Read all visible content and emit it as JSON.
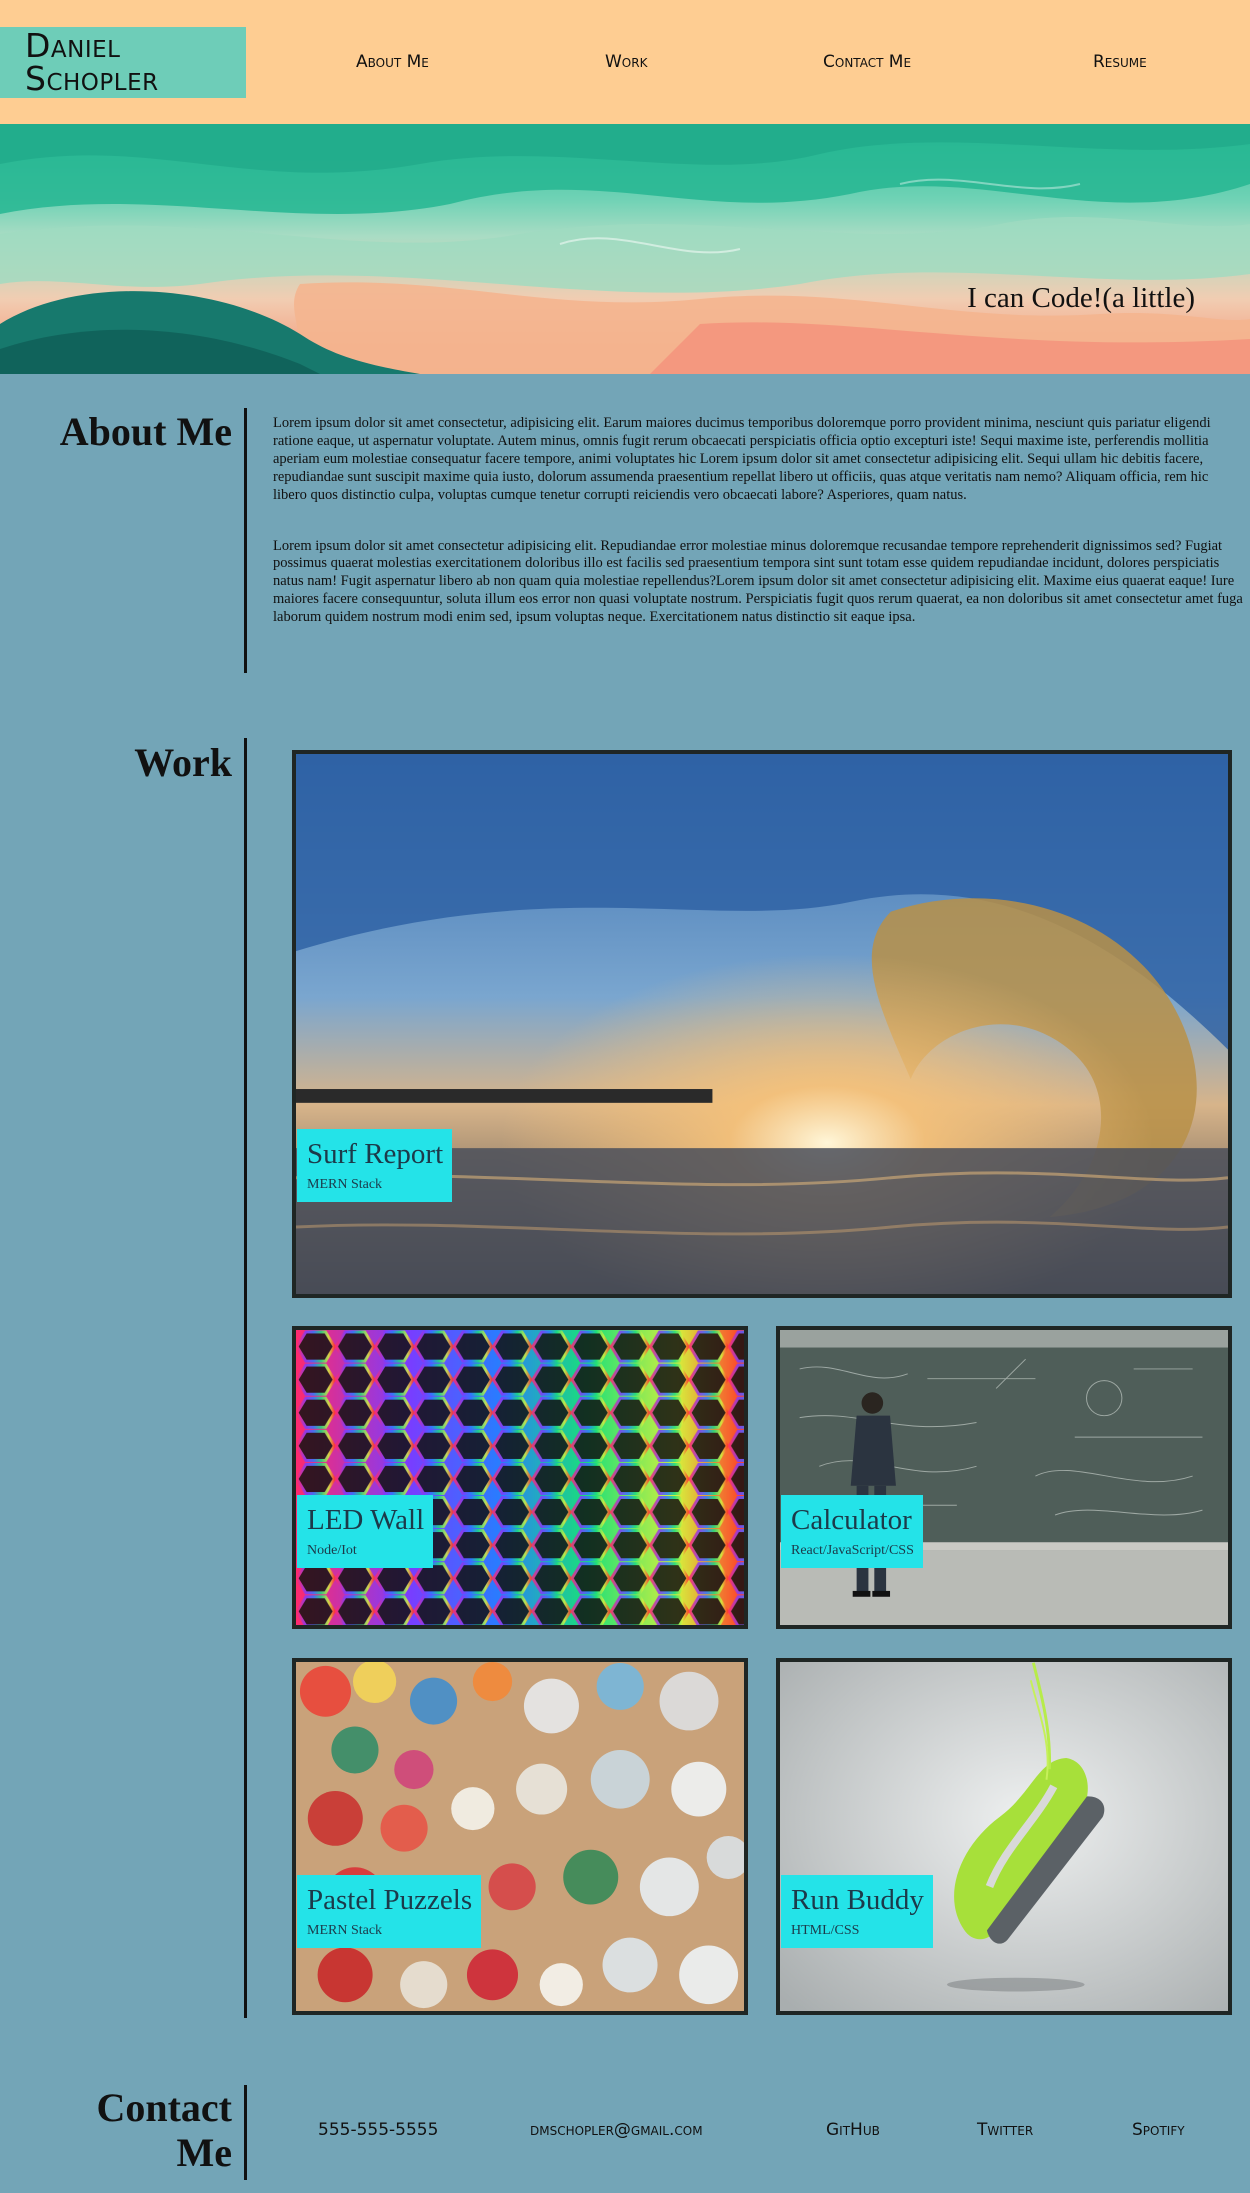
{
  "header": {
    "logo_line1": "Daniel",
    "logo_line2": "Schopler",
    "nav": [
      "About Me",
      "Work",
      "Contact Me",
      "Resume"
    ]
  },
  "hero": {
    "tagline": "I can Code!(a little)"
  },
  "about": {
    "title": "About Me",
    "paragraphs": [
      "Lorem ipsum dolor sit amet consectetur, adipisicing elit. Earum maiores ducimus temporibus doloremque porro provident minima, nesciunt quis pariatur eligendi ratione eaque, ut aspernatur voluptate. Autem minus, omnis fugit rerum obcaecati perspiciatis officia optio excepturi iste! Sequi maxime iste, perferendis mollitia aperiam eum molestiae consequatur facere tempore, animi voluptates hic Lorem ipsum dolor sit amet consectetur adipisicing elit. Sequi ullam hic debitis facere, repudiandae sunt suscipit maxime quia iusto, dolorum assumenda praesentium repellat libero ut officiis, quas atque veritatis nam nemo? Aliquam officia, rem hic libero quos distinctio culpa, voluptas cumque tenetur corrupti reiciendis vero obcaecati labore? Asperiores, quam natus.",
      "Lorem ipsum dolor sit amet consectetur adipisicing elit. Repudiandae error molestiae minus doloremque recusandae tempore reprehenderit dignissimos sed? Fugiat possimus quaerat molestias exercitationem doloribus illo est facilis sed praesentium tempora sint sunt totam esse quidem repudiandae incidunt, dolores perspiciatis natus nam! Fugit aspernatur libero ab non quam quia molestiae repellendus?Lorem ipsum dolor sit amet consectetur adipisicing elit. Maxime eius quaerat eaque! Iure maiores facere consequuntur, soluta illum eos error non quasi voluptate nostrum. Perspiciatis fugit quos rerum quaerat, ea non doloribus sit amet consectetur amet fuga laborum quidem nostrum modi enim sed, ipsum voluptas neque. Exercitationem natus distinctio sit eaque ipsa."
    ]
  },
  "work": {
    "title": "Work",
    "projects": [
      {
        "title": "Surf Report",
        "stack": "MERN Stack"
      },
      {
        "title": "LED Wall",
        "stack": "Node/Iot"
      },
      {
        "title": "Calculator",
        "stack": "React/JavaScript/CSS"
      },
      {
        "title": "Pastel Puzzels",
        "stack": "MERN Stack"
      },
      {
        "title": "Run Buddy",
        "stack": "HTML/CSS"
      }
    ]
  },
  "contact": {
    "title_line1": "Contact",
    "title_line2": "Me",
    "items": [
      "555-555-5555",
      "dmschopler@gmail.com",
      "GitHub",
      "Twitter",
      "Spotify"
    ]
  }
}
